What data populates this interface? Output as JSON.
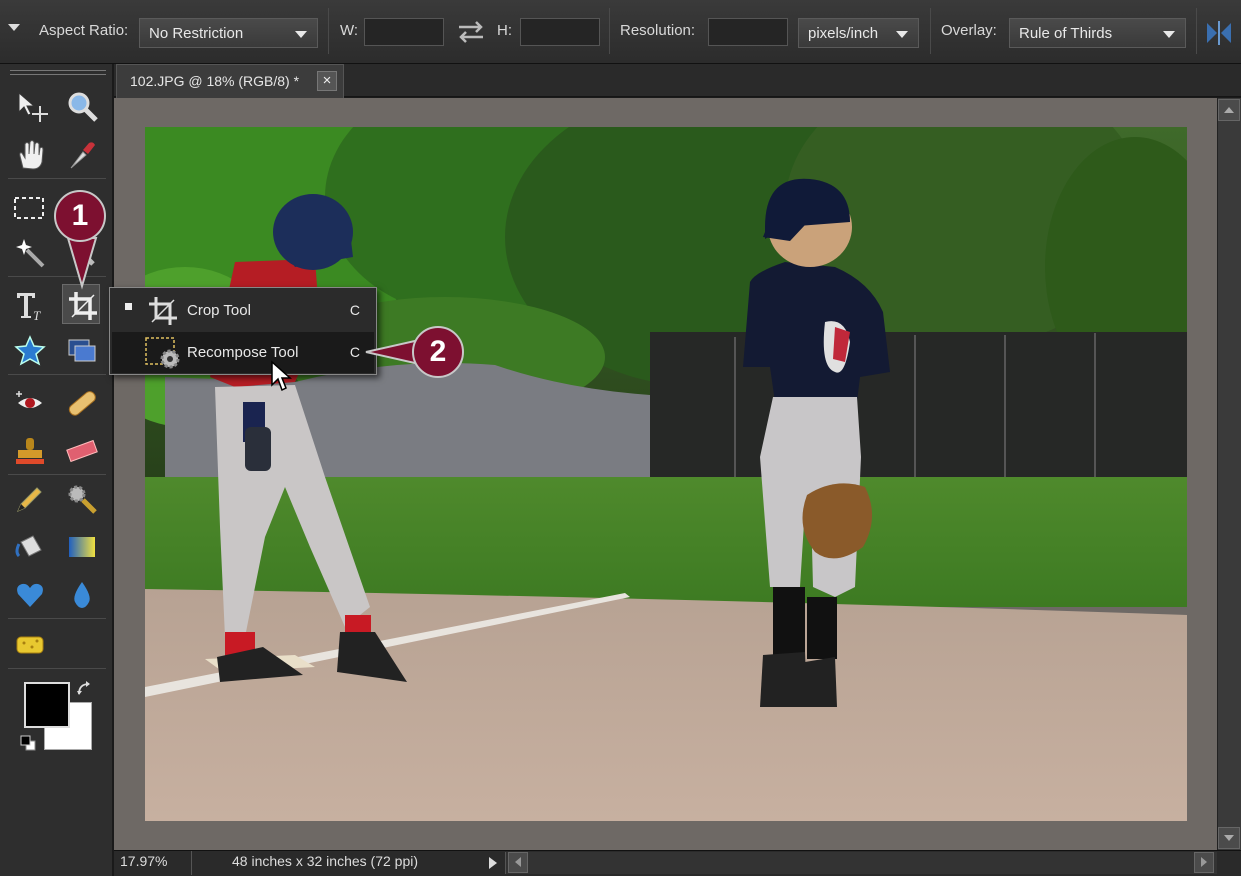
{
  "options_bar": {
    "aspect_ratio_label": "Aspect Ratio:",
    "aspect_ratio_value": "No Restriction",
    "width_label": "W:",
    "height_label": "H:",
    "resolution_label": "Resolution:",
    "resolution_unit": "pixels/inch",
    "overlay_label": "Overlay:",
    "overlay_value": "Rule of Thirds"
  },
  "document": {
    "tab_title": "102.JPG @ 18% (RGB/8) *",
    "close_glyph": "×"
  },
  "status_bar": {
    "zoom": "17.97%",
    "doc_size": "48 inches x 32 inches (72 ppi)"
  },
  "tools_flyout": {
    "items": [
      {
        "label": "Crop Tool",
        "shortcut": "C",
        "selected": true
      },
      {
        "label": "Recompose Tool",
        "shortcut": "C",
        "selected": false
      }
    ]
  },
  "callouts": [
    "1",
    "2"
  ],
  "colors": {
    "callout": "#7d1030",
    "foreground": "#000000",
    "background": "#ffffff"
  }
}
